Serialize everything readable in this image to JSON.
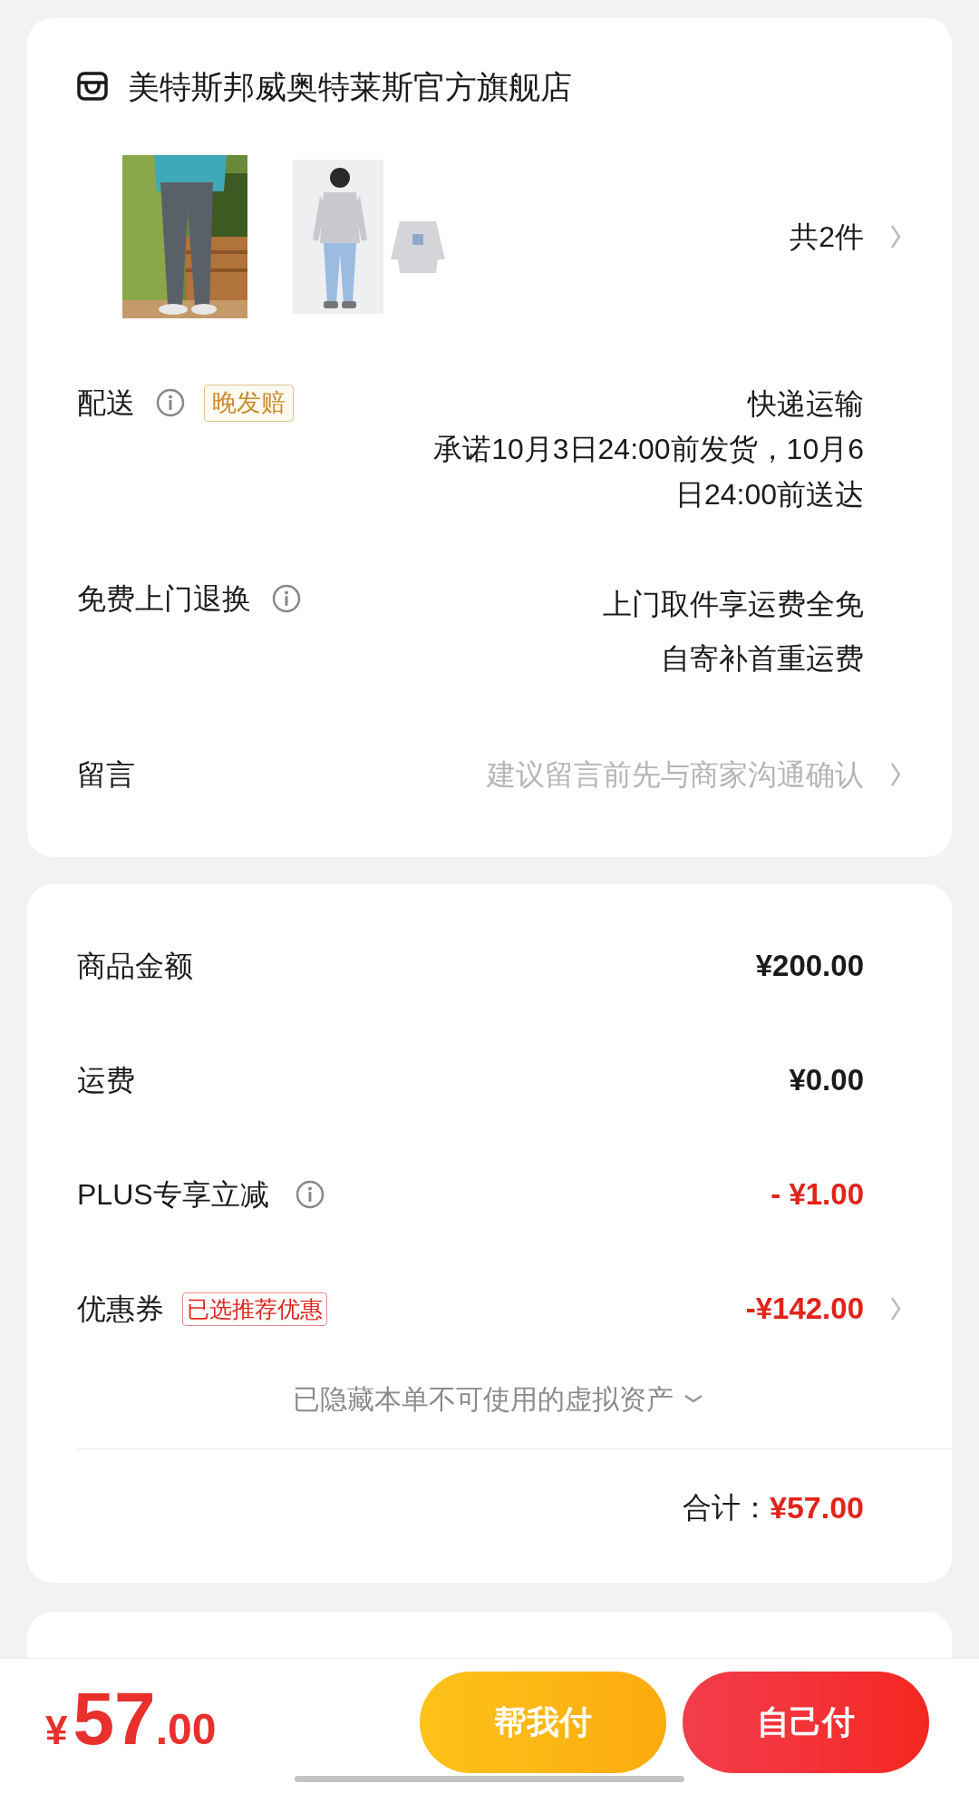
{
  "store": {
    "name": "美特斯邦威奥特莱斯官方旗舰店"
  },
  "products": {
    "count": "共2件"
  },
  "details": [
    {
      "kind": "delivery",
      "label": "配送",
      "info": true,
      "tag": "晚发赔",
      "lines": [
        "快递运输",
        "承诺10月3日24:00前发货，10月6",
        "日24:00前送达"
      ]
    },
    {
      "kind": "returns",
      "label": "免费上门退换",
      "info": true,
      "lines": [
        "上门取件享运费全免",
        "自寄补首重运费"
      ]
    },
    {
      "kind": "message",
      "label": "留言",
      "placeholder": "建议留言前先与商家沟通确认"
    }
  ],
  "price_rows": [
    {
      "label": "商品金额",
      "info": false,
      "value": "¥200.00",
      "kind": "charge",
      "link": false
    },
    {
      "label": "运费",
      "info": false,
      "value": "¥0.00",
      "kind": "charge",
      "link": false
    },
    {
      "label": "PLUS专享立减",
      "info": true,
      "value": "- ¥1.00",
      "kind": "discount",
      "link": false
    },
    {
      "label": "优惠券",
      "info": false,
      "tag": "已选推荐优惠",
      "value": "-¥142.00",
      "kind": "discount",
      "link": true
    }
  ],
  "hidden_assets": {
    "text": "已隐藏本单不可使用的虚拟资产",
    "expanded": false
  },
  "total": {
    "label": "合计：",
    "value": "¥57.00"
  },
  "footer": {
    "currency": "¥",
    "integer": "57",
    "decimal": ".00"
  },
  "buttons": [
    {
      "label": "帮我付",
      "kind": "secondary"
    },
    {
      "label": "自己付",
      "kind": "primary"
    }
  ]
}
